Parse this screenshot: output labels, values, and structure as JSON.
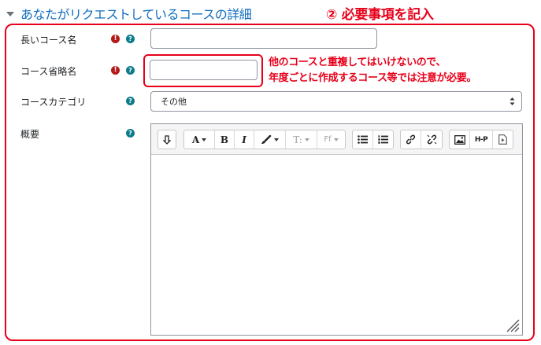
{
  "section": {
    "title": "あなたがリクエストしているコースの詳細"
  },
  "annotations": {
    "step_title": "② 必要事項を記入",
    "note_line1": "他のコースと重複してはいけないので、",
    "note_line2": "年度ごとに作成するコース等では注意が必要。",
    "highlight_color": "#e8001a"
  },
  "form": {
    "fullname": {
      "label": "長いコース名",
      "value": "",
      "required": true
    },
    "shortname": {
      "label": "コース省略名",
      "value": "",
      "required": true
    },
    "category": {
      "label": "コースカテゴリ",
      "selected": "その他"
    },
    "summary": {
      "label": "概要"
    },
    "required_icon": "!",
    "help_icon": "?"
  },
  "editor_toolbar": {
    "buttons": [
      "collapse-icon",
      "font-color-icon",
      "bold-icon",
      "italic-icon",
      "highlight-icon",
      "text-style-icon",
      "font-family-icon",
      "unordered-list-icon",
      "ordered-list-icon",
      "link-icon",
      "unlink-icon",
      "image-icon",
      "h5p-icon",
      "media-icon"
    ],
    "font_color_label": "A",
    "bold_label": "B",
    "italic_label": "I",
    "text_style_label": "T:",
    "font_family_label": "Ff",
    "h5p_label": "H-P"
  },
  "colors": {
    "link_blue": "#0f6cbf",
    "required_red": "#b41a1a",
    "help_teal": "#0c7b8a"
  }
}
